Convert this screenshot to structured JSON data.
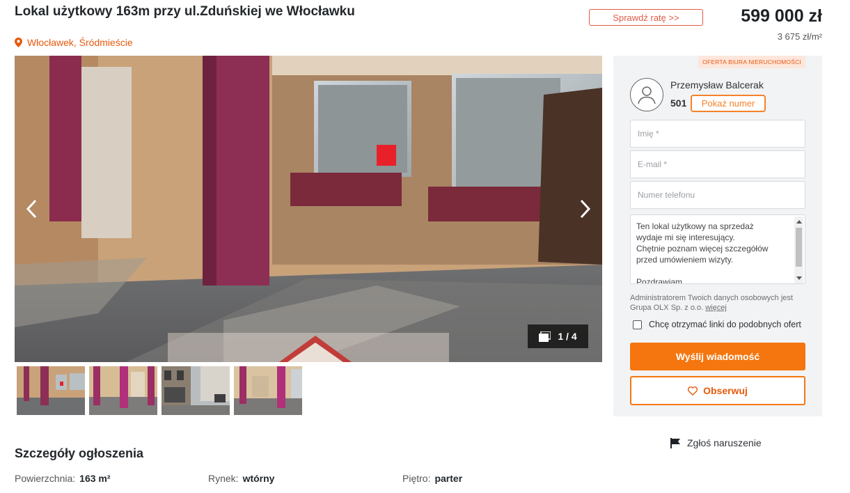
{
  "listing": {
    "title": "Lokal użytkowy 163m przy ul.Zduńskiej we Włocławku",
    "location": "Włocławek, Śródmieście",
    "location_icon": "map-pin-icon",
    "rate_button": "Sprawdź ratę >>",
    "price": "599 000 zł",
    "price_per_m2": "3 675 zł/m²"
  },
  "gallery": {
    "counter": "1 / 4",
    "thumbnails_count": 4
  },
  "contact": {
    "badge": "OFERTA BIURA NIERUCHOMOŚCI",
    "agent_name": "Przemysław Balcerak",
    "phone_prefix": "501",
    "show_number": "Pokaż numer",
    "name_placeholder": "Imię *",
    "email_placeholder": "E-mail *",
    "phone_placeholder": "Numer telefonu",
    "message": "Ten lokal użytkowy na sprzedaż\nwydaje mi się interesujący.\nChętnie poznam więcej szczegółów\nprzed umówieniem wizyty.\n\nPozdrawiam",
    "privacy_text": "Administratorem Twoich danych osobowych jest Grupa OLX Sp. z o.o.",
    "privacy_link": "więcej",
    "consent": "Chcę otrzymać linki do podobnych ofert",
    "send_button": "Wyślij wiadomość",
    "observe_button": "Obserwuj"
  },
  "report": "Zgłoś naruszenie",
  "details": {
    "title": "Szczegóły ogłoszenia",
    "items": [
      {
        "label": "Powierzchnia:",
        "value": "163 m²"
      },
      {
        "label": "Rynek:",
        "value": "wtórny"
      },
      {
        "label": "Piętro:",
        "value": "parter"
      }
    ]
  },
  "colors": {
    "accent": "#f5760f",
    "location": "#e8590c",
    "badge_bg": "#fde6dc"
  }
}
